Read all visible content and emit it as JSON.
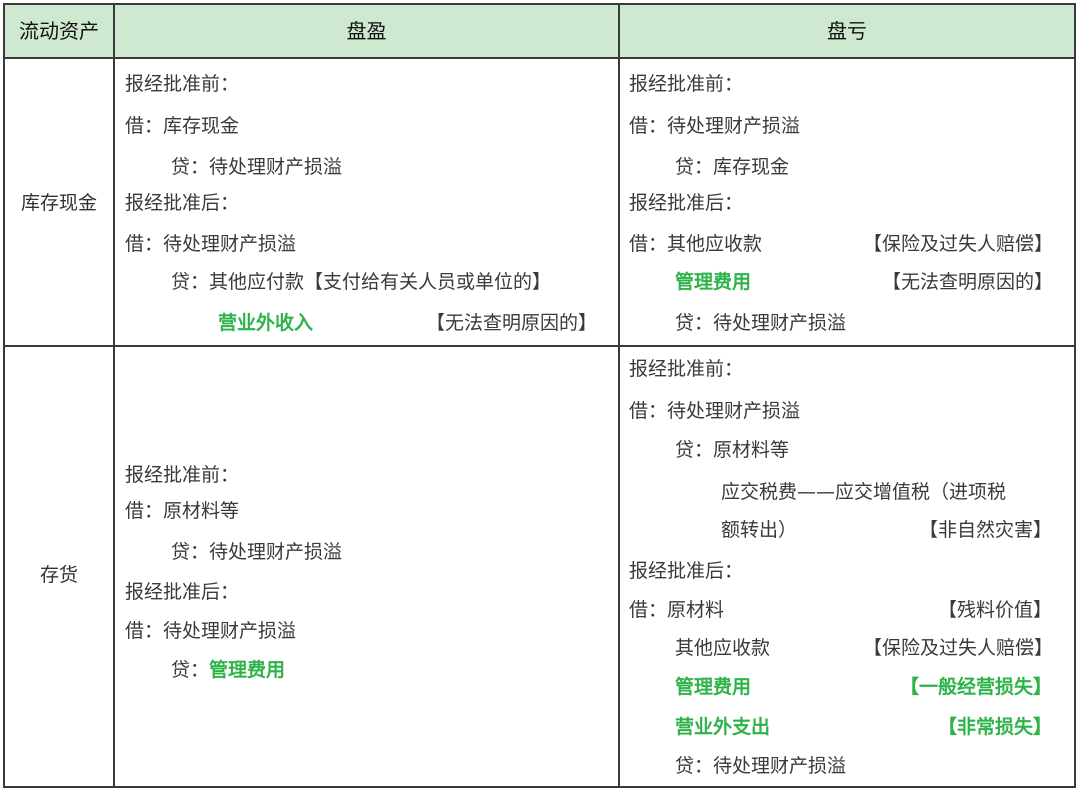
{
  "header": {
    "col1": "流动资产",
    "col2": "盘盈",
    "col3": "盘亏"
  },
  "cash": {
    "label": "库存现金",
    "surplus": {
      "pre": "报经批准前：",
      "debit": "借：库存现金",
      "credit": "贷：待处理财产损溢",
      "post": "报经批准后：",
      "debit2": "借：待处理财产损溢",
      "credit2": "贷：其他应付款【支付给有关人员或单位的】",
      "credit3_account": "营业外收入",
      "credit3_note": "【无法查明原因的】"
    },
    "shortage": {
      "pre": "报经批准前：",
      "debit": "借：待处理财产损溢",
      "credit": "贷：库存现金",
      "post": "报经批准后：",
      "debit2_account": "借：其他应收款",
      "debit2_note": "【保险及过失人赔偿】",
      "debit3_account": "管理费用",
      "debit3_note": "【无法查明原因的】",
      "credit2": "贷：待处理财产损溢"
    }
  },
  "inventory": {
    "label": "存货",
    "surplus": {
      "pre": "报经批准前：",
      "debit": "借：原材料等",
      "credit": "贷：待处理财产损溢",
      "post": "报经批准后：",
      "debit2": "借：待处理财产损溢",
      "credit2_prefix": "贷：",
      "credit2_account": "管理费用"
    },
    "shortage": {
      "pre": "报经批准前：",
      "debit": "借：待处理财产损溢",
      "credit": "贷：原材料等",
      "tax_line1": "应交税费——应交增值税（进项税",
      "tax_line2": "额转出）",
      "tax_note": "【非自然灾害】",
      "post": "报经批准后：",
      "debit2_account": "借：原材料",
      "debit2_note": "【残料价值】",
      "debit3_account": "其他应收款",
      "debit3_note": "【保险及过失人赔偿】",
      "debit4_account": "管理费用",
      "debit4_note": "【一般经营损失】",
      "debit5_account": "营业外支出",
      "debit5_note": "【非常损失】",
      "credit2": "贷：待处理财产损溢"
    }
  },
  "colors": {
    "header_bg": "#cfe8d0",
    "accent_green": "#2eb34a",
    "border": "#3a3a3a"
  }
}
